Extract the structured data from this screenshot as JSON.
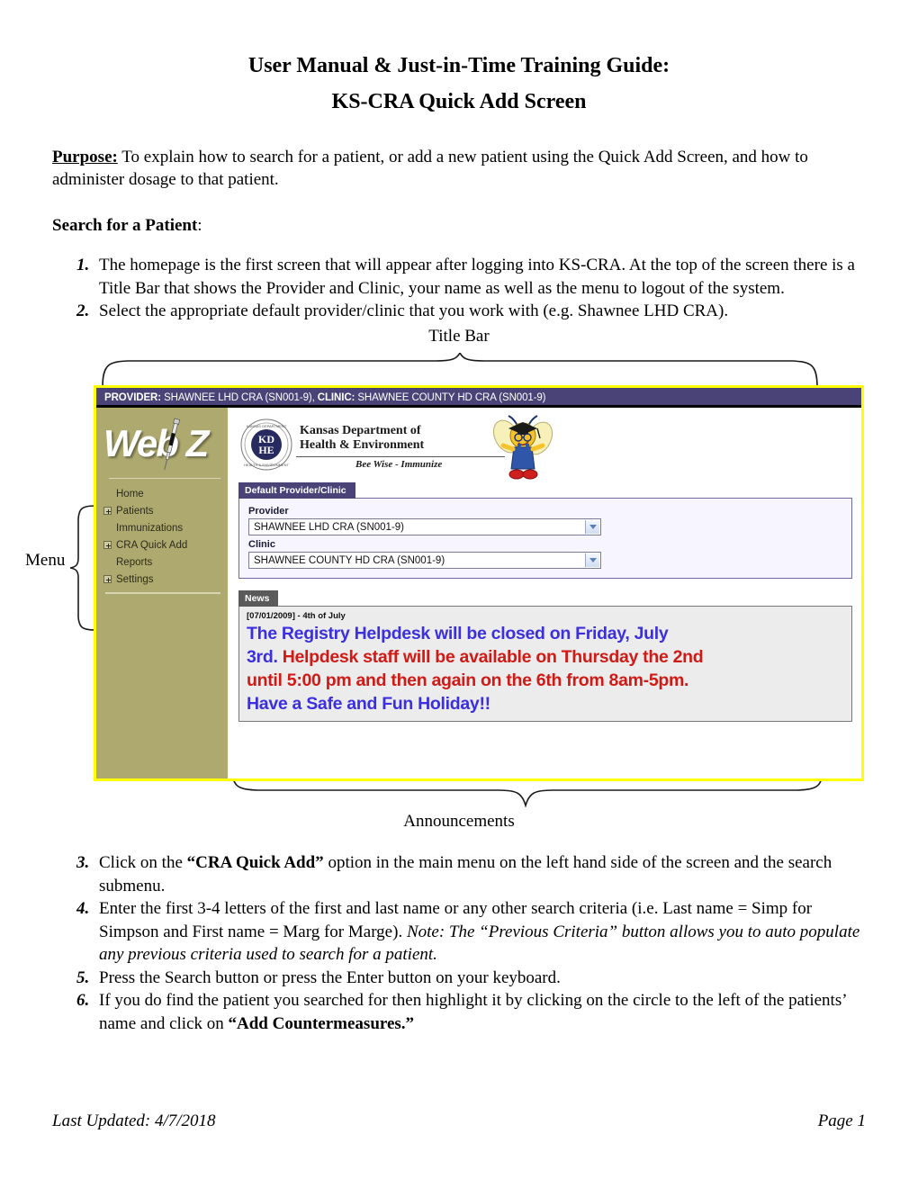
{
  "document": {
    "title_line1": "User Manual & Just-in-Time Training Guide:",
    "title_line2": "KS-CRA Quick Add Screen",
    "purpose_label": "Purpose:",
    "purpose_text": "To explain how to search for a patient, or add a new patient using the Quick Add Screen, and how to administer dosage to that patient.",
    "section_heading": "Search for a Patient",
    "section_heading_colon": ":"
  },
  "steps_top": [
    "The homepage is the first screen that will appear after logging into KS-CRA.  At the top of the screen there is a Title Bar that shows the Provider and Clinic, your name as well as the menu to logout of the system.",
    "Select the appropriate default provider/clinic that you work with (e.g. Shawnee LHD CRA)."
  ],
  "steps_bottom": {
    "item3": {
      "pre": "Click on the ",
      "bold": "“CRA Quick Add”",
      "post": " option in the main menu on the left hand side of the screen and the search submenu."
    },
    "item4": {
      "pre": "Enter the first 3-4 letters of the first and last name or any other search criteria (i.e. Last name = Simp for Simpson and First name = Marg for Marge).  ",
      "italic": "Note: The “Previous Criteria” button allows you to auto populate any previous criteria used to search for a patient."
    },
    "item5": {
      "text": "Press the Search button or press the Enter button on your keyboard."
    },
    "item6": {
      "pre": "If you do find the patient you searched for then highlight it by clicking on the circle to the left of the patients’ name and click on ",
      "bold": "“Add Countermeasures.”"
    }
  },
  "callouts": {
    "title_bar": "Title Bar",
    "menu": "Menu",
    "announcements": "Announcements"
  },
  "screenshot": {
    "titlebar": {
      "provider_label": "PROVIDER:",
      "provider_value": " SHAWNEE LHD CRA (SN001-9), ",
      "clinic_label": "CLINIC:",
      "clinic_value": " SHAWNEE COUNTY HD CRA (SN001-9)"
    },
    "logo": {
      "webiz": "WebIZ",
      "webiz_pre": "Web",
      "webiz_post": "Z",
      "kdhe_seal_text": "KDHE",
      "kdhe_line1": "Kansas Department of",
      "kdhe_line2": "Health & Environment",
      "kdhe_tagline": "Bee Wise - Immunize"
    },
    "menu_items": [
      {
        "label": "Home",
        "expandable": false
      },
      {
        "label": "Patients",
        "expandable": true
      },
      {
        "label": "Immunizations",
        "expandable": false
      },
      {
        "label": "CRA Quick Add",
        "expandable": true
      },
      {
        "label": "Reports",
        "expandable": false
      },
      {
        "label": "Settings",
        "expandable": true
      }
    ],
    "provider_panel": {
      "tab": "Default Provider/Clinic",
      "provider_label": "Provider",
      "provider_value": "SHAWNEE LHD CRA (SN001-9)",
      "clinic_label": "Clinic",
      "clinic_value": "SHAWNEE COUNTY HD CRA (SN001-9)"
    },
    "news_panel": {
      "tab": "News",
      "date_line": "[07/01/2009] - 4th of July",
      "line1_blue": "The Registry Helpdesk will be closed on Friday, July",
      "line2_blue": "3rd.",
      "line2_red": "Helpdesk staff will be available on Thursday the 2nd",
      "line3_red": "until 5:00 pm and then again on the 6th from 8am-5pm.",
      "line4_blue": "Have a Safe and Fun Holiday!!"
    },
    "colors": {
      "titlebar_bg": "#4a4377",
      "frame_border": "#ffff00",
      "sidebar_bg": "#aeaa6f",
      "panel_tab_bg": "#4a4377",
      "news_tab_bg": "#5a5a5a",
      "news_blue": "#3b2fe0",
      "news_red": "#d01a16"
    }
  },
  "footer": {
    "last_updated": "Last Updated: 4/7/2018",
    "page": "Page 1"
  }
}
